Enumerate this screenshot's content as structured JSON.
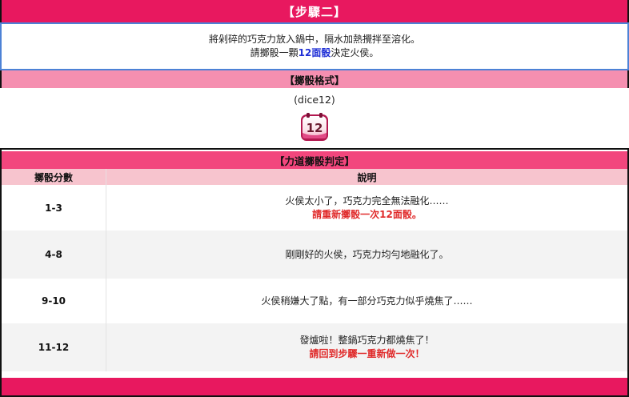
{
  "step": {
    "title": "【步驟二】"
  },
  "instructions": {
    "line1": "將剁碎的巧克力放入鍋中，隔水加熱攪拌至溶化。",
    "line2_prefix": "請擲骰一顆",
    "line2_highlight": "12面骰",
    "line2_suffix": "決定火侯。",
    "highlight_color": "#1f2fd6"
  },
  "dice_format": {
    "header": "【擲骰格式】",
    "command": "(dice12)",
    "icon": "dice-12-icon",
    "icon_text": "12"
  },
  "judgement": {
    "header": "【力道擲骰判定】",
    "columns": [
      "擲骰分數",
      "說明"
    ],
    "rows": [
      {
        "score": "1-3",
        "desc": "火侯太小了，巧克力完全無法融化……",
        "note": "請重新擲骰一次12面骰。"
      },
      {
        "score": "4-8",
        "desc": "剛剛好的火侯，巧克力均勻地融化了。",
        "note": ""
      },
      {
        "score": "9-10",
        "desc": "火侯稍嫌大了點，有一部分巧克力似乎燒焦了……",
        "note": ""
      },
      {
        "score": "11-12",
        "desc": "發爐啦！整鍋巧克力都燒焦了！",
        "note": "請回到步驟一重新做一次！"
      }
    ]
  },
  "colors": {
    "primary_pink": "#e8185f",
    "light_pink": "#f58fb0",
    "header_pink": "#f2467d",
    "table_header": "#f7c4ce",
    "warning_red": "#e02a2a",
    "instruction_border": "#4d82d6"
  }
}
